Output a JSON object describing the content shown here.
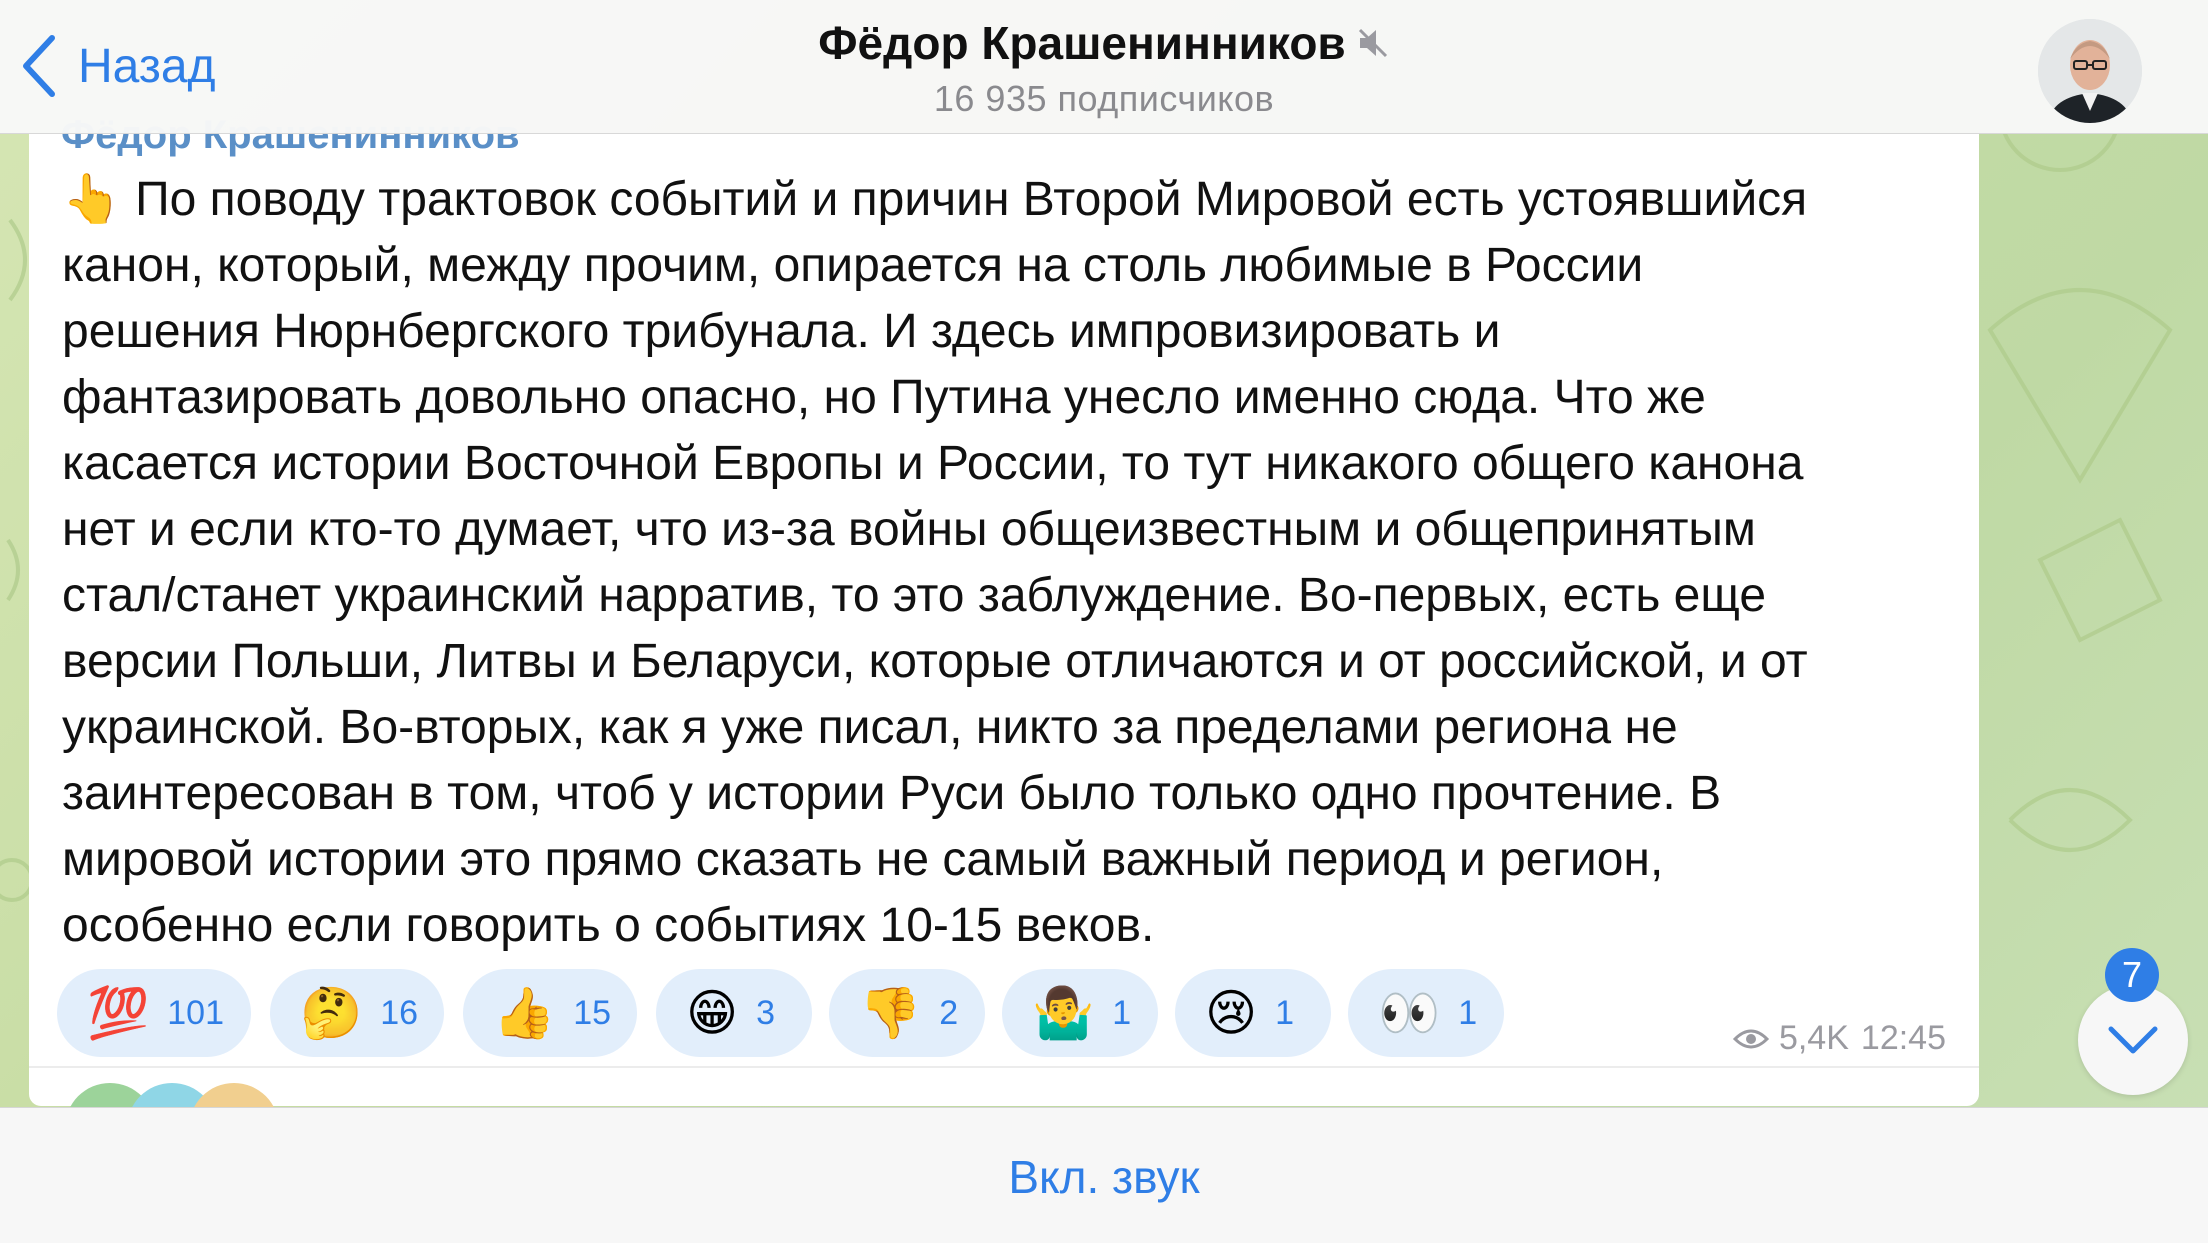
{
  "header": {
    "back_label": "Назад",
    "channel_name": "Фёдор Крашенинников",
    "subscribers": "16 935 подписчиков"
  },
  "message": {
    "author": "Фёдор Крашенинников",
    "lines": [
      "👆 По поводу трактовок событий и причин Второй Мировой есть устоявшийся",
      "канон, который, между прочим, опирается на столь любимые в России",
      "решения Нюрнбергского трибунала. И здесь импровизировать и",
      "фантазировать довольно опасно, но Путина унесло именно сюда. Что же",
      "касается истории Восточной Европы и России, то тут никакого общего канона",
      "нет и если кто-то думает, что из-за войны общеизвестным и общепринятым",
      "стал/станет украинский нарратив, то это заблуждение. Во-первых, есть еще",
      "версии Польши, Литвы и Беларуси, которые отличаются и от российской, и от",
      "украинской. Во-вторых, как я уже писал, никто за пределами региона не",
      "заинтересован в том, чтоб у истории Руси было только одно прочтение. В",
      "мировой истории это прямо сказать не самый важный период и регион,",
      "особенно если говорить о событиях 10-15 веков."
    ],
    "reactions": [
      {
        "emoji": "💯",
        "count": "101"
      },
      {
        "emoji": "🤔",
        "count": "16"
      },
      {
        "emoji": "👍",
        "count": "15"
      },
      {
        "emoji": "😁",
        "count": "3"
      },
      {
        "emoji": "👎",
        "count": "2"
      },
      {
        "emoji": "🤷‍♂️",
        "count": "1"
      },
      {
        "emoji": "😢",
        "count": "1"
      },
      {
        "emoji": "👀",
        "count": "1"
      }
    ],
    "views": "5,4K",
    "time": "12:45"
  },
  "scroll": {
    "unread_count": "7"
  },
  "bottom": {
    "sound_label": "Вкл. звук"
  },
  "colors": {
    "accent": "#2f7ee6",
    "reaction_bg": "#e2eefb",
    "author": "#5a8fc7"
  }
}
